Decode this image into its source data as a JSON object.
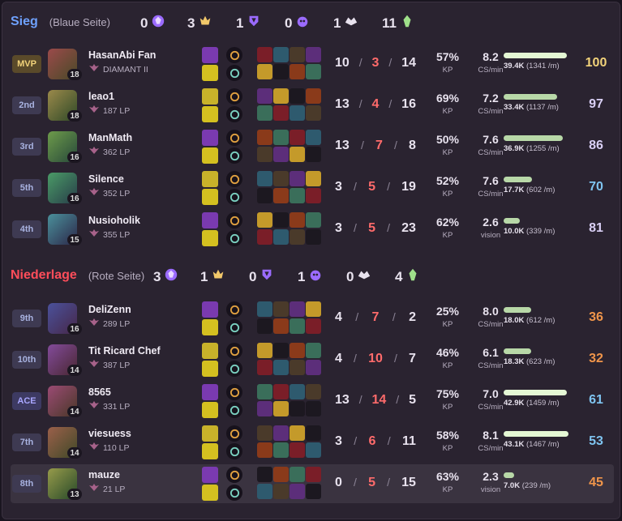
{
  "teams": [
    {
      "name": "Sieg",
      "side": "(Blaue Seite)",
      "name_color": "#6fa2ff",
      "objectives": [
        {
          "icon": "baron-icon",
          "value": "0"
        },
        {
          "icon": "dragon-icon",
          "value": "3"
        },
        {
          "icon": "herald-icon",
          "value": "1"
        },
        {
          "icon": "grub-icon",
          "value": "0"
        },
        {
          "icon": "inhibitor-icon",
          "value": "1"
        },
        {
          "icon": "tower-icon",
          "value": "11"
        }
      ],
      "players": [
        {
          "rank": "MVP",
          "name": "HasanAbi Fan",
          "tier": "DIAMANT II",
          "level": "18",
          "kills": "10",
          "deaths": "3",
          "assists": "14",
          "kp": "57%",
          "kp_label": "KP",
          "cs": "8.2",
          "cs_label": "CS/min",
          "damage": "39.4K",
          "damage_detail": "(1341 /m)",
          "damage_frac": 0.98,
          "score": "100",
          "score_color": "#f2d37a"
        },
        {
          "rank": "2nd",
          "name": "leao1",
          "tier": "187 LP",
          "level": "18",
          "kills": "13",
          "deaths": "4",
          "assists": "16",
          "kp": "69%",
          "kp_label": "KP",
          "cs": "7.2",
          "cs_label": "CS/min",
          "damage": "33.4K",
          "damage_detail": "(1137 /m)",
          "damage_frac": 0.83,
          "score": "97",
          "score_color": "#d9cff5"
        },
        {
          "rank": "3rd",
          "name": "ManMath",
          "tier": "362 LP",
          "level": "16",
          "kills": "13",
          "deaths": "7",
          "assists": "8",
          "kp": "50%",
          "kp_label": "KP",
          "cs": "7.6",
          "cs_label": "CS/min",
          "damage": "36.9K",
          "damage_detail": "(1255 /m)",
          "damage_frac": 0.91,
          "score": "86",
          "score_color": "#d9cff5"
        },
        {
          "rank": "5th",
          "name": "Silence",
          "tier": "352 LP",
          "level": "16",
          "kills": "3",
          "deaths": "5",
          "assists": "19",
          "kp": "52%",
          "kp_label": "KP",
          "cs": "7.6",
          "cs_label": "CS/min",
          "damage": "17.7K",
          "damage_detail": "(602 /m)",
          "damage_frac": 0.44,
          "score": "70",
          "score_color": "#7fc4f0"
        },
        {
          "rank": "4th",
          "name": "Nusioholik",
          "tier": "355 LP",
          "level": "15",
          "kills": "3",
          "deaths": "5",
          "assists": "23",
          "kp": "62%",
          "kp_label": "KP",
          "cs": "2.6",
          "cs_label": "vision",
          "damage": "10.0K",
          "damage_detail": "(339 /m)",
          "damage_frac": 0.25,
          "score": "81",
          "score_color": "#d9cff5"
        }
      ]
    },
    {
      "name": "Niederlage",
      "side": "(Rote Seite)",
      "name_color": "#ff4d5a",
      "objectives": [
        {
          "icon": "baron-icon",
          "value": "3"
        },
        {
          "icon": "dragon-icon",
          "value": "1"
        },
        {
          "icon": "herald-icon",
          "value": "0"
        },
        {
          "icon": "grub-icon",
          "value": "1"
        },
        {
          "icon": "inhibitor-icon",
          "value": "0"
        },
        {
          "icon": "tower-icon",
          "value": "4"
        }
      ],
      "players": [
        {
          "rank": "9th",
          "name": "DeliZenn",
          "tier": "289 LP",
          "level": "16",
          "kills": "4",
          "deaths": "7",
          "assists": "2",
          "kp": "25%",
          "kp_label": "KP",
          "cs": "8.0",
          "cs_label": "CS/min",
          "damage": "18.0K",
          "damage_detail": "(612 /m)",
          "damage_frac": 0.42,
          "score": "36",
          "score_color": "#f0954a"
        },
        {
          "rank": "10th",
          "name": "Tit Ricard Chef",
          "tier": "387 LP",
          "level": "14",
          "kills": "4",
          "deaths": "10",
          "assists": "7",
          "kp": "46%",
          "kp_label": "KP",
          "cs": "6.1",
          "cs_label": "CS/min",
          "damage": "18.3K",
          "damage_detail": "(623 /m)",
          "damage_frac": 0.43,
          "score": "32",
          "score_color": "#f0954a"
        },
        {
          "rank": "ACE",
          "name": "8565",
          "tier": "331 LP",
          "level": "14",
          "kills": "13",
          "deaths": "14",
          "assists": "5",
          "kp": "75%",
          "kp_label": "KP",
          "cs": "7.0",
          "cs_label": "CS/min",
          "damage": "42.9K",
          "damage_detail": "(1459 /m)",
          "damage_frac": 0.98,
          "score": "61",
          "score_color": "#7fc4f0"
        },
        {
          "rank": "7th",
          "name": "viesuess",
          "tier": "110 LP",
          "level": "14",
          "kills": "3",
          "deaths": "6",
          "assists": "11",
          "kp": "58%",
          "kp_label": "KP",
          "cs": "8.1",
          "cs_label": "CS/min",
          "damage": "43.1K",
          "damage_detail": "(1467 /m)",
          "damage_frac": 1.0,
          "score": "53",
          "score_color": "#7fc4f0"
        },
        {
          "rank": "8th",
          "name": "mauze",
          "tier": "21 LP",
          "level": "13",
          "kills": "0",
          "deaths": "5",
          "assists": "15",
          "kp": "63%",
          "kp_label": "KP",
          "cs": "2.3",
          "cs_label": "vision",
          "damage": "7.0K",
          "damage_detail": "(239 /m)",
          "damage_frac": 0.16,
          "score": "45",
          "score_color": "#f0954a"
        }
      ]
    }
  ],
  "colors": {
    "item_palette": [
      "#7a1e28",
      "#2e5a6e",
      "#4a3a2a",
      "#5c2e7a",
      "#c49a2a",
      "#1c1820",
      "#8a3a1a",
      "#3a6e5a"
    ]
  }
}
